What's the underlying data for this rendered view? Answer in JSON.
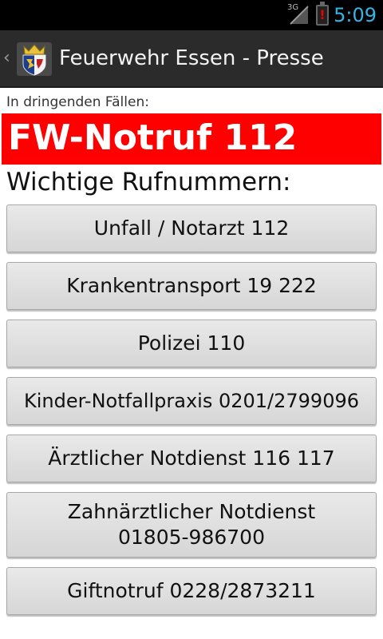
{
  "status_bar": {
    "network_type": "3G",
    "time": "5:09",
    "battery_alert": "!"
  },
  "action_bar": {
    "title": "Feuerwehr Essen - Presse",
    "up_caret": "‹"
  },
  "urgent": {
    "label": "In dringenden Fällen:",
    "banner_text": "FW-Notruf 112",
    "banner_color": "#ff0000"
  },
  "section_heading": "Wichtige Rufnummern:",
  "buttons": [
    {
      "line1": "Unfall / Notarzt 112",
      "line2": ""
    },
    {
      "line1": "Krankentransport 19 222",
      "line2": ""
    },
    {
      "line1": "Polizei 110",
      "line2": ""
    },
    {
      "line1": "Kinder-Notfallpraxis 0201/2799096",
      "line2": ""
    },
    {
      "line1": "Ärztlicher Notdienst 116 117",
      "line2": ""
    },
    {
      "line1": "Zahnärztlicher Notdienst",
      "line2": "01805-986700"
    },
    {
      "line1": "Giftnotruf 0228/2873211",
      "line2": ""
    }
  ],
  "colors": {
    "accent_clock": "#33b5e5",
    "action_bar": "#2b2b2b"
  }
}
